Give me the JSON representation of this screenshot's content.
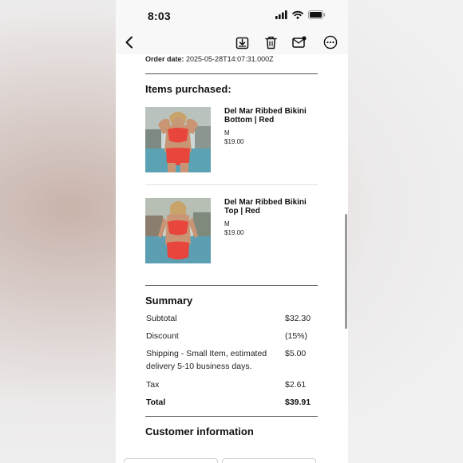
{
  "status": {
    "time": "8:03"
  },
  "toolbar": {
    "back_icon": "chevron-left-icon",
    "archive_icon": "archive-download-icon",
    "trash_icon": "trash-icon",
    "mail_icon": "mail-unread-icon",
    "more_icon": "more-ellipsis-icon"
  },
  "order": {
    "date_label": "Order date:",
    "date_value": "2025-05-28T14:07:31.000Z"
  },
  "items_heading": "Items purchased:",
  "items": [
    {
      "title": "Del Mar Ribbed Bikini Bottom | Red",
      "size": "M",
      "price": "$19.00"
    },
    {
      "title": "Del Mar Ribbed Bikini Top | Red",
      "size": "M",
      "price": "$19.00"
    }
  ],
  "summary": {
    "heading": "Summary",
    "rows": [
      {
        "label": "Subtotal",
        "value": "$32.30"
      },
      {
        "label": "Discount",
        "value": "(15%)"
      },
      {
        "label": "Shipping - Small Item, estimated delivery 5-10 business days.",
        "value": "$5.00"
      },
      {
        "label": "Tax",
        "value": "$2.61"
      },
      {
        "label": "Total",
        "value": "$39.91"
      }
    ]
  },
  "customer_heading": "Customer information",
  "colors": {
    "swimsuit": "#e8453c",
    "water": "#5a9fb0",
    "link": "#111111"
  }
}
